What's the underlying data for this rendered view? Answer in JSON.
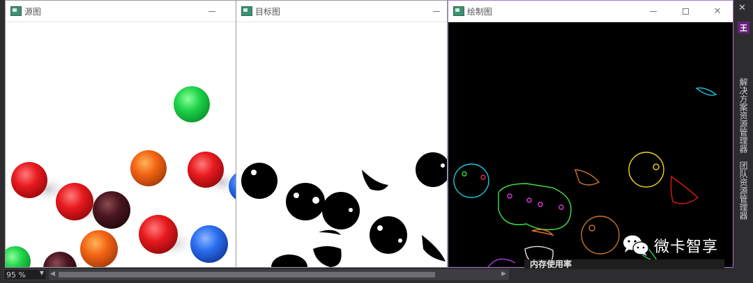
{
  "windows": {
    "source": {
      "title": "源图"
    },
    "target": {
      "title": "目标图"
    },
    "draw": {
      "title": "绘制图"
    }
  },
  "right_strip": {
    "badge": "王",
    "label1": "解决方案资源管理器",
    "label2": "团队资源管理器"
  },
  "bottom": {
    "zoom": "95 %",
    "panel_label": "内存使用率"
  },
  "watermark": {
    "text": "微卡智享",
    "icon": "wechat-icon"
  },
  "colors": {
    "vs_background": "#2d2d30",
    "canvas_black": "#000000",
    "accent_purple": "#68217a"
  }
}
